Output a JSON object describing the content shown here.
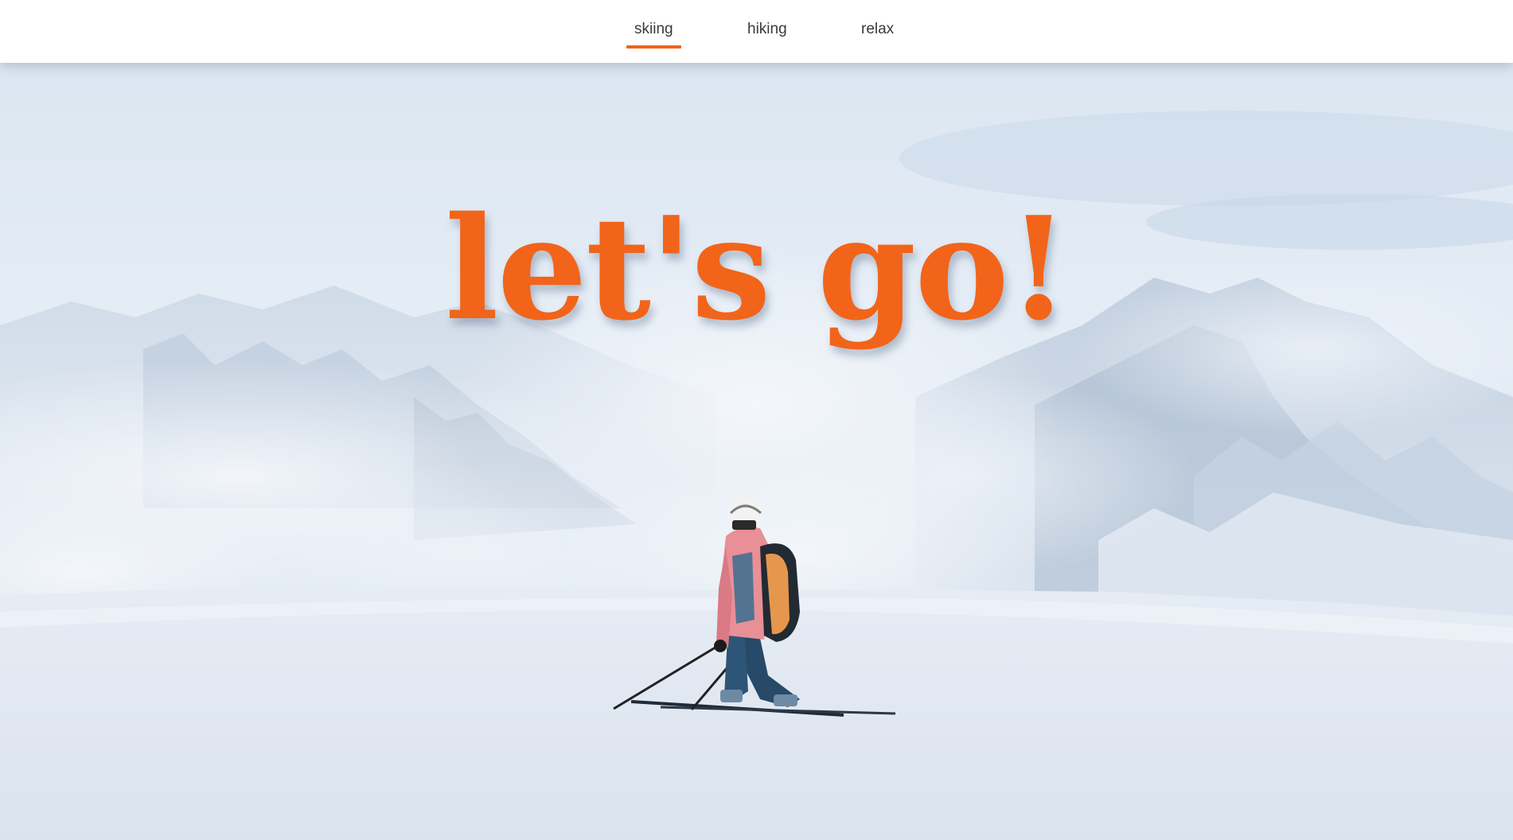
{
  "nav": {
    "tabs": [
      {
        "label": "skiing",
        "active": true
      },
      {
        "label": "hiking",
        "active": false
      },
      {
        "label": "relax",
        "active": false
      }
    ],
    "accent_color": "#f26419"
  },
  "hero": {
    "title": "let's go!",
    "title_color": "#f26419",
    "image_subject": "skier-on-snowy-mountain"
  }
}
